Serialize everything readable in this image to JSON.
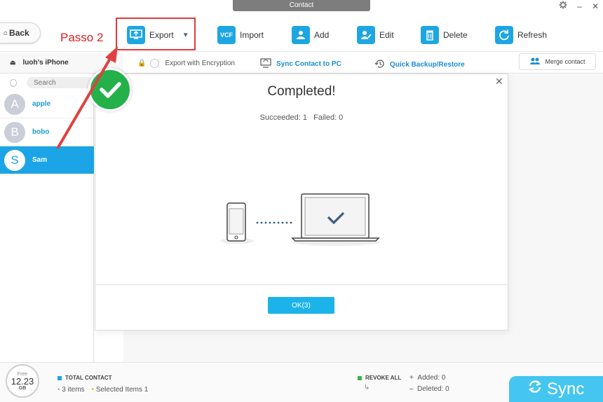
{
  "window": {
    "title": "Contact"
  },
  "toolbar": {
    "back_label": "Back",
    "annotation": "Passo 2",
    "export_label": "Export",
    "import_label": "Import",
    "import_badge": "VCF",
    "add_label": "Add",
    "edit_label": "Edit",
    "delete_label": "Delete",
    "refresh_label": "Refresh"
  },
  "device": {
    "name": "luoh's iPhone"
  },
  "subtoolbar": {
    "encryption_label": "Export with Encryption",
    "sync_to_pc": "Sync Contact to PC",
    "quick_backup": "Quick Backup/Restore",
    "merge": "Merge contact"
  },
  "search": {
    "placeholder": "Search"
  },
  "contacts": [
    {
      "initial": "A",
      "name": "apple"
    },
    {
      "initial": "B",
      "name": "bobo"
    },
    {
      "initial": "S",
      "name": "Sam",
      "selected": true
    }
  ],
  "dialog": {
    "title": "Completed!",
    "stats": "Succeeded: 1   Failed: 0",
    "ok_label": "OK(3)"
  },
  "footer": {
    "storage": {
      "free": "Free",
      "value": "12.23",
      "unit": "GB"
    },
    "total_contact": "TOTAL CONTACT",
    "items": "3 items",
    "selected_items": "Selected Items 1",
    "revoke_all": "REVOKE ALL",
    "added": "Added: 0",
    "deleted": "Deleted: 0",
    "sync_label": "Sync"
  },
  "colors": {
    "accent": "#1ca5e6",
    "highlight_red": "#e23b3b",
    "success_green": "#24b14a"
  }
}
